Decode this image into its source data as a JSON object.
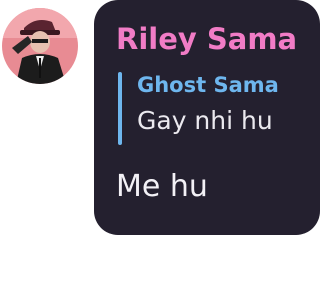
{
  "message": {
    "sender_name": "Riley Sama",
    "reply": {
      "sender_name": "Ghost Sama",
      "text": "Gay nhi hu"
    },
    "text": "Me hu"
  },
  "colors": {
    "bubble_background": "#24202f",
    "sender_name": "#f17cc6",
    "reply_accent": "#6eb6ee",
    "text": "#f3f1f6"
  },
  "icons": {
    "avatar": "user-avatar-photo"
  }
}
